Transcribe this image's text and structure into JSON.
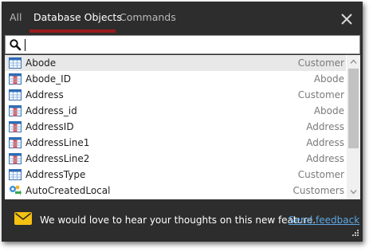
{
  "tabs": {
    "all": "All",
    "database_objects": "Database Objects",
    "commands": "Commands",
    "active": "database_objects"
  },
  "search": {
    "value": "",
    "placeholder": ""
  },
  "results": [
    {
      "name": "Abode",
      "owner": "Customer",
      "icon": "table-icon",
      "selected": true
    },
    {
      "name": "Abode_ID",
      "owner": "Abode",
      "icon": "column-icon",
      "selected": false
    },
    {
      "name": "Address",
      "owner": "Customer",
      "icon": "table-icon",
      "selected": false
    },
    {
      "name": "Address_id",
      "owner": "Abode",
      "icon": "column-icon",
      "selected": false
    },
    {
      "name": "AddressID",
      "owner": "Address",
      "icon": "column-icon",
      "selected": false
    },
    {
      "name": "AddressLine1",
      "owner": "Address",
      "icon": "column-icon",
      "selected": false
    },
    {
      "name": "AddressLine2",
      "owner": "Address",
      "icon": "column-icon",
      "selected": false
    },
    {
      "name": "AddressType",
      "owner": "Customer",
      "icon": "table-icon",
      "selected": false
    },
    {
      "name": "AutoCreatedLocal",
      "owner": "Customers",
      "icon": "route-icon",
      "selected": false
    }
  ],
  "footer": {
    "message": "We would love to hear your thoughts on this new feature.",
    "link": "Send feedback",
    "icon": "mail-icon"
  },
  "colors": {
    "panel": "#2d2d2d",
    "tab_underline": "#9b1b1b",
    "link": "#5da7e4",
    "mail_icon": "#f5c211",
    "selected_row": "#e8e8e8"
  }
}
